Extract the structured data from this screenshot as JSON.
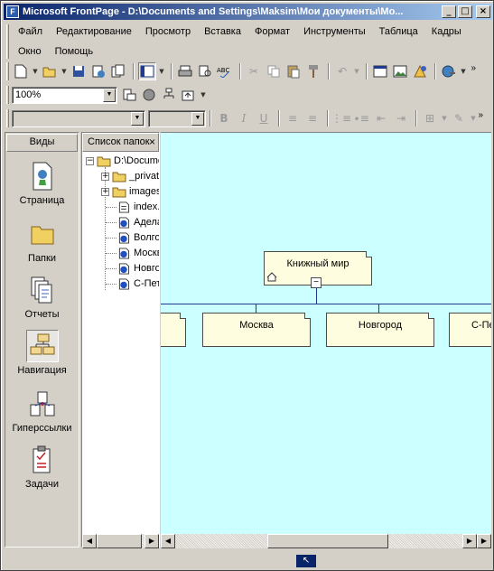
{
  "window": {
    "title": "Microsoft FrontPage - D:\\Documents and Settings\\Maksim\\Мои документы\\Мо..."
  },
  "menu": {
    "items": [
      "Файл",
      "Редактирование",
      "Просмотр",
      "Вставка",
      "Формат",
      "Инструменты",
      "Таблица",
      "Кадры",
      "Окно",
      "Помощь"
    ]
  },
  "toolbar": {
    "zoom_value": "100%"
  },
  "views_bar": {
    "header": "Виды",
    "items": [
      {
        "label": "Страница",
        "icon": "page-view-icon"
      },
      {
        "label": "Папки",
        "icon": "folders-view-icon"
      },
      {
        "label": "Отчеты",
        "icon": "reports-view-icon"
      },
      {
        "label": "Навигация",
        "icon": "navigation-view-icon",
        "selected": true
      },
      {
        "label": "Гиперссылки",
        "icon": "hyperlinks-view-icon"
      },
      {
        "label": "Задачи",
        "icon": "tasks-view-icon"
      }
    ]
  },
  "folder_list": {
    "header": "Список папок",
    "close": "×",
    "root": "D:\\Documents and Settings",
    "items": [
      {
        "label": "_private",
        "type": "folder"
      },
      {
        "label": "images",
        "type": "folder"
      },
      {
        "label": "index.htm",
        "type": "page"
      },
      {
        "label": "Аделаида.htm",
        "type": "linked-page"
      },
      {
        "label": "Волгоград.htm",
        "type": "linked-page"
      },
      {
        "label": "Москва.htm",
        "type": "linked-page"
      },
      {
        "label": "Новгород.htm",
        "type": "linked-page"
      },
      {
        "label": "С-Петербург.htm",
        "type": "linked-page"
      }
    ]
  },
  "navigation": {
    "root": "Книжный мир",
    "children": [
      "",
      "Москва",
      "Новгород",
      "С-Петербург"
    ],
    "collapse_symbol": "−"
  },
  "colors": {
    "canvas_bg": "#ccffff",
    "node_bg": "#fffde0",
    "connector": "#1f3a8a",
    "title_gradient_start": "#0a246a"
  }
}
